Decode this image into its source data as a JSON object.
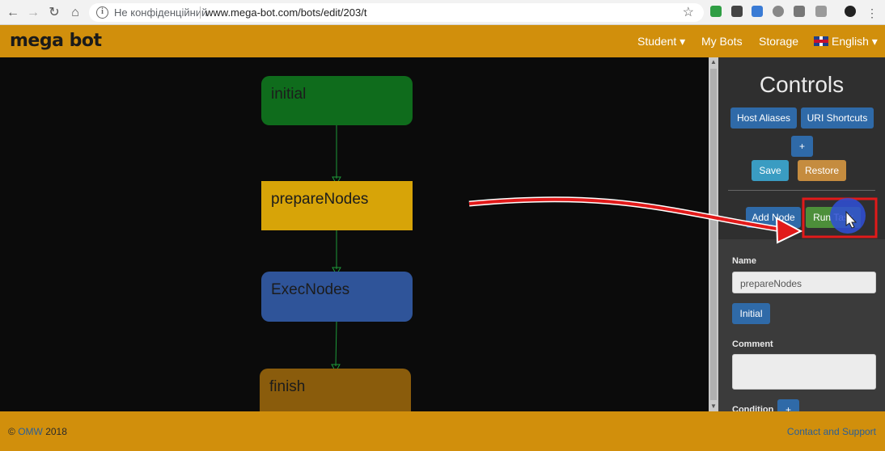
{
  "browser": {
    "security_label": "Не конфіденційний",
    "url": "www.mega-bot.com/bots/edit/203/t"
  },
  "navbar": {
    "logo": "mega bot",
    "links": [
      "Student ▾",
      "My Bots",
      "Storage"
    ],
    "language": "English ▾"
  },
  "flow": {
    "nodes": [
      {
        "label": "initial",
        "color": "#0f6c1c"
      },
      {
        "label": "prepareNodes",
        "color": "#d7a408"
      },
      {
        "label": "ExecNodes",
        "color": "#2f5499"
      },
      {
        "label": "finish",
        "color": "#8a5c0c"
      }
    ],
    "edge_color": "#1e9a3a"
  },
  "controls": {
    "title": "Controls",
    "host_aliases": "Host Aliases",
    "uri_shortcuts": "URI Shortcuts",
    "plus": "+",
    "save": "Save",
    "restore": "Restore",
    "add_node": "Add Node",
    "run_task": "Run Task",
    "name_label": "Name",
    "name_value": "prepareNodes",
    "initial_button": "Initial",
    "comment_label": "Comment",
    "condition_label": "Condition",
    "condition_plus": "+"
  },
  "annotation": {
    "highlight_color": "#e11a1a"
  },
  "footer": {
    "copyright_prefix": "©",
    "owner": "OMW",
    "year": "2018",
    "contact": "Contact and Support"
  }
}
